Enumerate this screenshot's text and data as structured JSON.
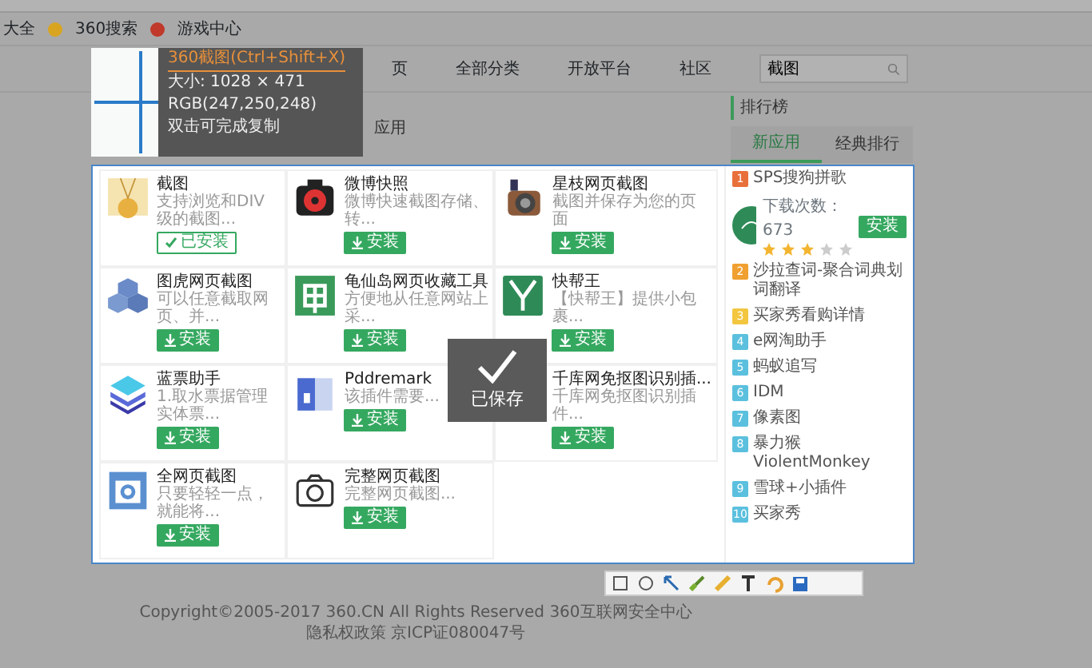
{
  "bookmarks": [
    {
      "label": "大全"
    },
    {
      "label": "360搜索"
    },
    {
      "label": "游戏中心"
    }
  ],
  "nav": {
    "items": [
      "页",
      "全部分类",
      "开放平台",
      "社区"
    ],
    "search": {
      "value": "截图"
    }
  },
  "section_heading": "应用",
  "apps": [
    {
      "name": "截图",
      "description": "支持浏览和DIV级的截图...",
      "button": "已安装",
      "installed": true
    },
    {
      "name": "微博快照",
      "description": "微博快速截图存储、转...",
      "button": "安装",
      "installed": false
    },
    {
      "name": "星枝网页截图",
      "description": "截图并保存为您的页面",
      "button": "安装",
      "installed": false
    },
    {
      "name": "图虎网页截图",
      "description": "可以任意截取网页、并...",
      "button": "安装",
      "installed": false
    },
    {
      "name": "龟仙岛网页收藏工具",
      "description": "方便地从任意网站上采...",
      "button": "安装",
      "installed": false
    },
    {
      "name": "快帮王",
      "description": "【快帮王】提供小包裹...",
      "button": "安装",
      "installed": false
    },
    {
      "name": "蓝票助手",
      "description": "1.取水票据管理实体票...",
      "button": "安装",
      "installed": false
    },
    {
      "name": "Pddremark",
      "description": "该插件需要...",
      "button": "安装",
      "installed": false
    },
    {
      "name": "千库网免抠图识别插...",
      "description": "千库网免抠图识别插件...",
      "button": "安装",
      "installed": false
    },
    {
      "name": "全网页截图",
      "description": "只要轻轻一点，就能将...",
      "button": "安装",
      "installed": false
    },
    {
      "name": "完整网页截图",
      "description": "完整网页截图...",
      "button": "安装",
      "installed": false
    }
  ],
  "ranking": {
    "title": "排行榜",
    "tabs": [
      {
        "label": "新应用",
        "selected": true
      },
      {
        "label": "经典排行",
        "selected": false
      }
    ],
    "items": [
      {
        "rank": "1",
        "name": "SPS搜狗拼歌",
        "color": "#e8703a",
        "expanded": true,
        "downloads": "下载次数：673",
        "stars": 3,
        "button": "安装"
      },
      {
        "rank": "2",
        "name": "沙拉查词-聚合词典划词翻译",
        "color": "#f0a030",
        "expanded": false
      },
      {
        "rank": "3",
        "name": "买家秀看购详情",
        "color": "#f3c640",
        "expanded": false
      },
      {
        "rank": "4",
        "name": "e网淘助手",
        "color": "#5bc0de",
        "expanded": false
      },
      {
        "rank": "5",
        "name": "蚂蚁追写",
        "color": "#5bc0de",
        "expanded": false
      },
      {
        "rank": "6",
        "name": "IDM",
        "color": "#5bc0de",
        "expanded": false
      },
      {
        "rank": "7",
        "name": "像素图",
        "color": "#5bc0de",
        "expanded": false
      },
      {
        "rank": "8",
        "name": "暴力猴ViolentMonkey",
        "color": "#5bc0de",
        "expanded": false
      },
      {
        "rank": "9",
        "name": "雪球+小插件",
        "color": "#5bc0de",
        "expanded": false
      },
      {
        "rank": "10",
        "name": "买家秀",
        "color": "#5bc0de",
        "expanded": false
      }
    ]
  },
  "magnifier": {
    "title": "360截图(Ctrl+Shift+X)",
    "size": "大小: 1028 × 471",
    "rgb": "RGB(247,250,248)",
    "hint": "双击可完成复制"
  },
  "toast": {
    "text": "已保存"
  },
  "footer": {
    "copyright": "Copyright©2005-2017 360.CN All Rights Reserved 360互联网安全中心",
    "icp": "隐私权政策 京ICP证080047号"
  }
}
